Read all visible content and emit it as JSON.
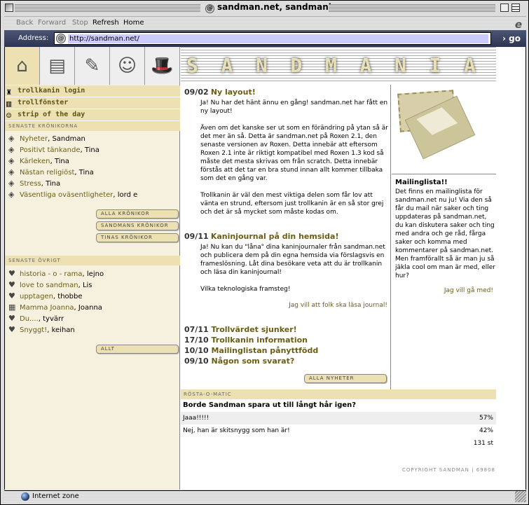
{
  "window": {
    "title": "sandman.net, sandmania"
  },
  "toolbar": {
    "back": "Back",
    "forward": "Forward",
    "stop": "Stop",
    "refresh": "Refresh",
    "home": "Home"
  },
  "address": {
    "label": "Address:",
    "url": "http://sandman.net/",
    "go": "go"
  },
  "nav_icons": [
    "home-icon",
    "notes-icon",
    "write-icon",
    "smiley-icon",
    "magic-hat-icon"
  ],
  "sidebar": {
    "links": [
      {
        "label": "trollkanin login",
        "icon": "bunny-hat-icon"
      },
      {
        "label": "trollfönster",
        "icon": "window-icon"
      },
      {
        "label": "strip of the day",
        "icon": "smiley-icon"
      }
    ],
    "columns_header": "SENASTE KRÖNIKORNA",
    "columns": [
      {
        "title": "Nyheter",
        "author": "Sandman"
      },
      {
        "title": "Positivt tänkande",
        "author": "Tina"
      },
      {
        "title": "Kärleken",
        "author": "Tina"
      },
      {
        "title": "Nästan religiöst",
        "author": "Tina"
      },
      {
        "title": "Stress",
        "author": "Tina"
      },
      {
        "title": "Väsentliga oväsentligheter",
        "author": "lord e"
      }
    ],
    "column_buttons": [
      "ALLA KRÖNIKOR",
      "SANDMANS KRÖNIKOR",
      "TINAS KRÖNIKOR"
    ],
    "other_header": "SENASTE ÖVRIGT",
    "other": [
      {
        "title": "historia - o - rama",
        "author": "lejno",
        "icon": "heart-icon"
      },
      {
        "title": "love to sandman",
        "author": "Lis",
        "icon": "heart-icon"
      },
      {
        "title": "upptagen",
        "author": "thobbe",
        "icon": "heart-icon"
      },
      {
        "title": "Mamma Joanna",
        "author": "Joanna",
        "icon": "book-icon"
      },
      {
        "title": "Du....",
        "author": "tyvärr",
        "icon": "heart-icon"
      },
      {
        "title": "Snyggt!",
        "author": "keihan",
        "icon": "heart-icon"
      }
    ],
    "other_button": "ALLT"
  },
  "banner": {
    "letters": [
      "S",
      "A",
      "N",
      "D",
      "M",
      "A",
      "N",
      "I",
      "A"
    ]
  },
  "news": [
    {
      "date": "09/02",
      "title": "Ny layout!",
      "paragraphs": [
        "Ja! Nu har det hänt ännu en gång! sandman.net har fått en ny layout!",
        "Även om det kanske ser ut som en förändring på ytan så är det mer än så. Detta är sandman.net på Roxen 2.1, den senaste versionen av Roxen. Detta innebär att eftersom Roxen 2.1 inte är riktigt kompatibel med Roxen 1.3 kod så måste det mesta skrivas om från scratch. Detta innebär förstås att det tar en bra stund innan allt kommer tillbaka som det en gång var.",
        "Trollkanin är väl den mest viktiga delen som får lov att vänta en strund, eftersom just trollkanin är en så stor grej och det är så mycket som måste kodas om."
      ]
    },
    {
      "date": "09/11",
      "title": "Kaninjournal på din hemsida!",
      "paragraphs": [
        "Ja! Nu kan du \"låna\" dina kaninjournaler från sandman.net och publicera dem på din egna hemsida via förslagsvis en frameslösning. Låt dina besökare veta att du är trollkanin och läsa din kaninjournal!",
        "Vilka teknologiska framsteg!"
      ],
      "more": "Jag vill att folk ska läsa journal!"
    }
  ],
  "older_news": [
    {
      "date": "07/11",
      "title": "Trollvärdet sjunker!"
    },
    {
      "date": "17/10",
      "title": "Trollkanin information"
    },
    {
      "date": "10/10",
      "title": "Mailinglistan pånyttfödd"
    },
    {
      "date": "09/10",
      "title": "Någon som svarat?"
    }
  ],
  "all_news_button": "ALLA NYHETER",
  "mailing": {
    "title": "Mailinglista!!",
    "body": "Det finns en mailinglista för sandman.net nu ju! Via den så får du mail när saker och ting uppdateras på sandman.net, du kan diskutera saker och ting med andra och ge råd, fårga saker och komma med kommentarer på sandman.net. Men framförallt så är man ju så jäkla cool om man är med, eller hur?",
    "link": "Jag vill gå med!"
  },
  "poll": {
    "header": "RÖSTA-O-MATIC",
    "question": "Borde Sandman spara ut till långt hår igen?",
    "options": [
      {
        "label": "Jaaa!!!!!",
        "percent": "57%"
      },
      {
        "label": "Nej, han är skitsnygg som han är!",
        "percent": "42%"
      }
    ],
    "total": "131 st"
  },
  "copyright": "COPYRIGHT SANDMAN | 69808",
  "status": {
    "text": "Internet zone"
  }
}
